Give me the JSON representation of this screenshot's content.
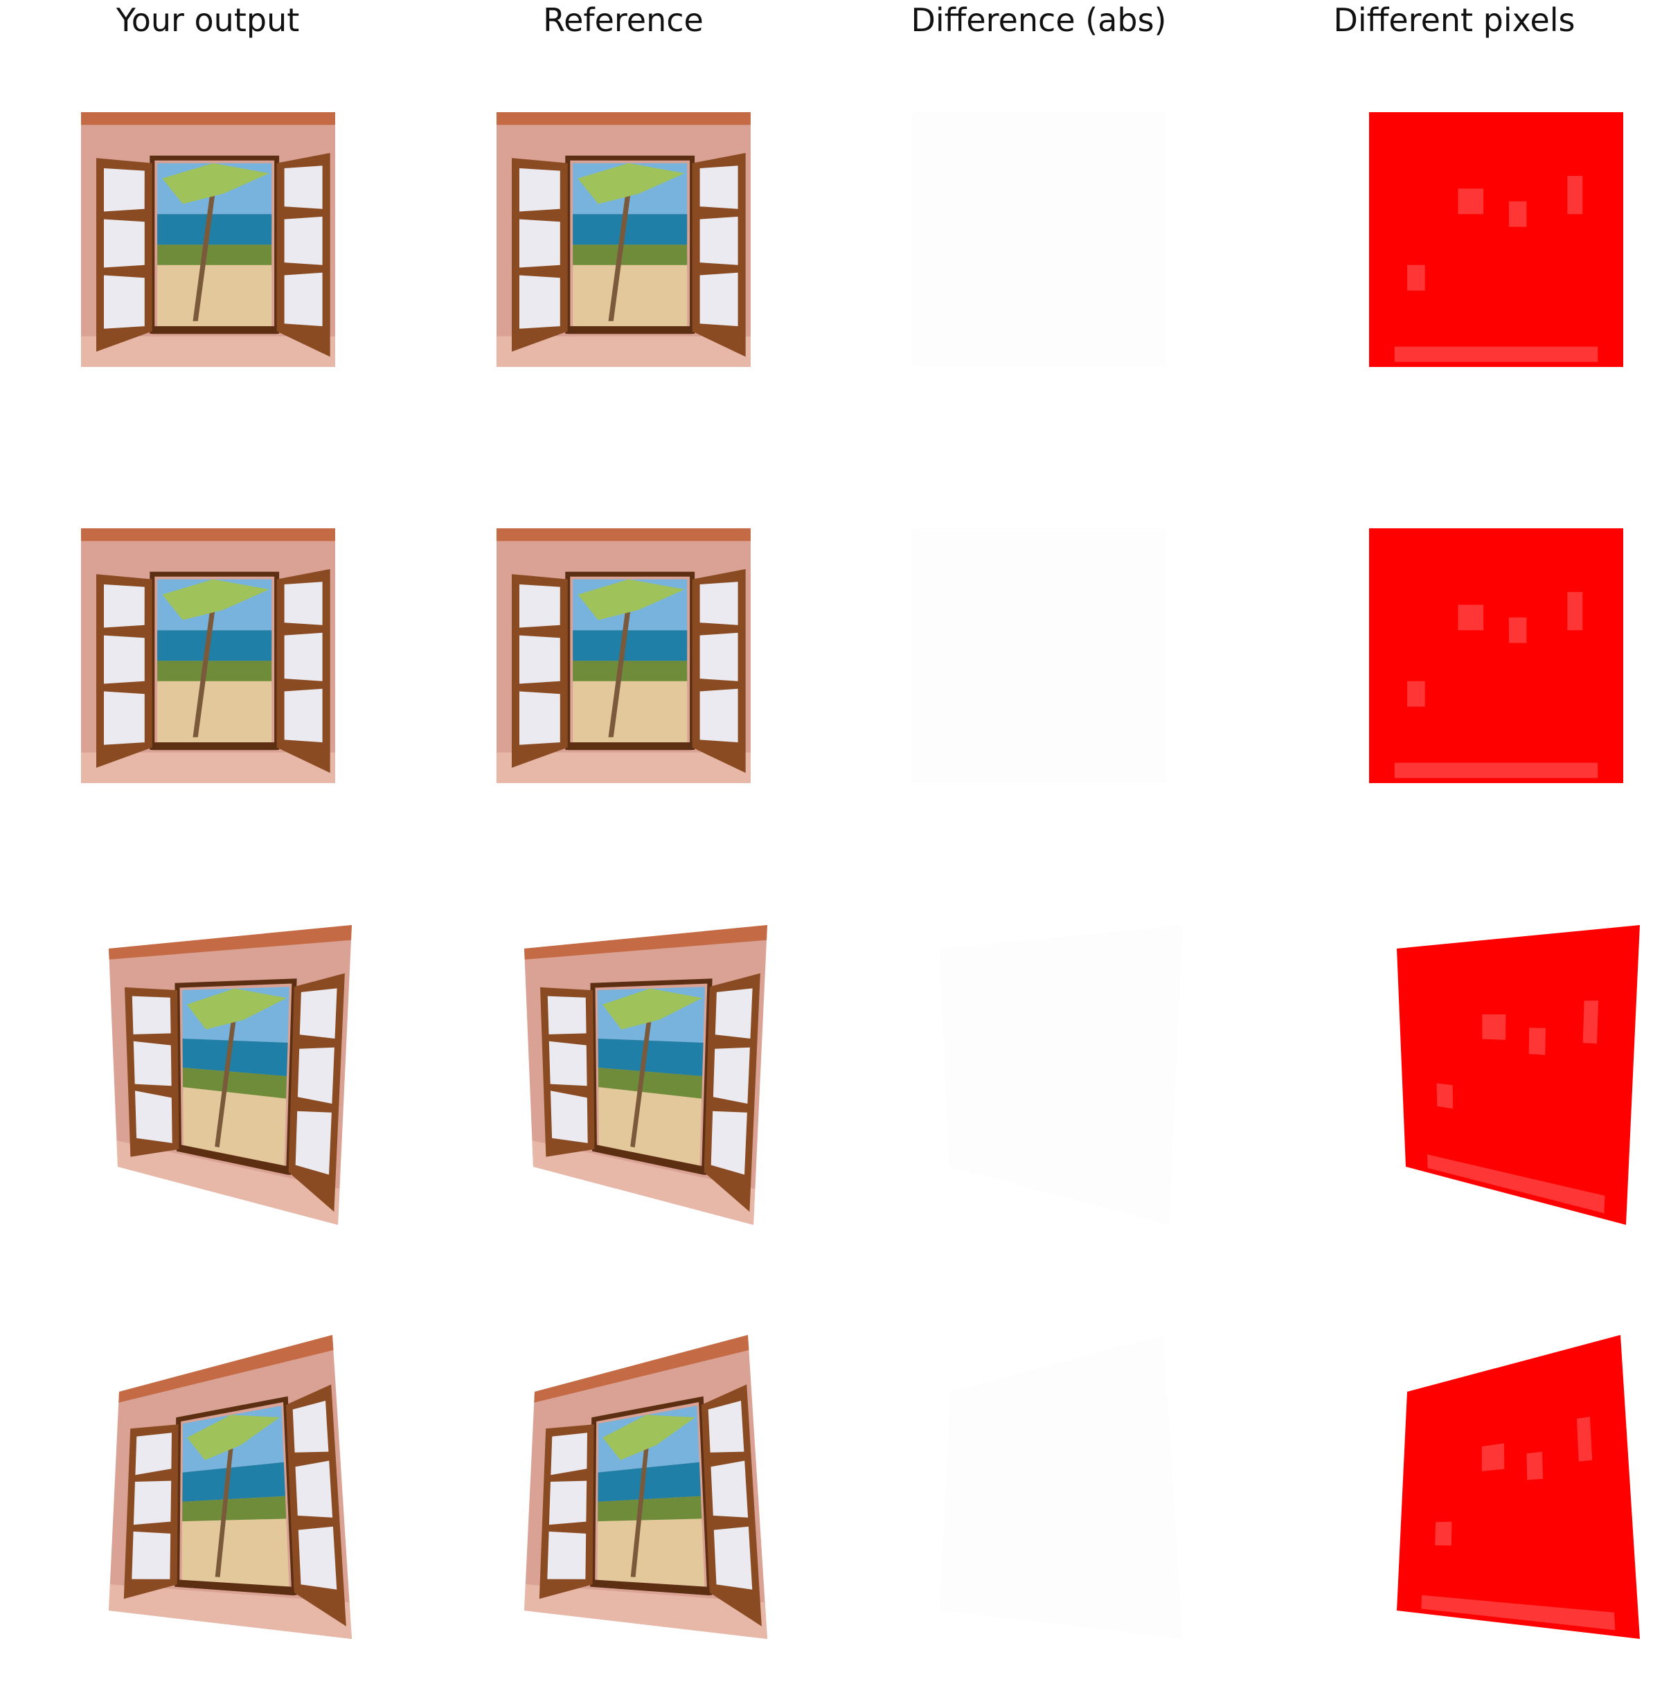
{
  "headers": [
    "Your output",
    "Reference",
    "Difference (abs)",
    "Different pixels"
  ],
  "colors": {
    "wall": "#d9a294",
    "wall_dark": "#b97c6c",
    "cornice": "#c46a44",
    "frame": "#8a4b22",
    "frame_dark": "#5c2e12",
    "sill": "#e7b8a8",
    "sky": "#77b3dd",
    "sea": "#1f7fa7",
    "sand": "#e2c89a",
    "grass": "#6f8c3a",
    "palm": "#9fc35a",
    "trunk": "#7b5a3c",
    "curtain": "#eaeaf0",
    "diff_red": "#ff0000",
    "background": "#ffffff"
  }
}
